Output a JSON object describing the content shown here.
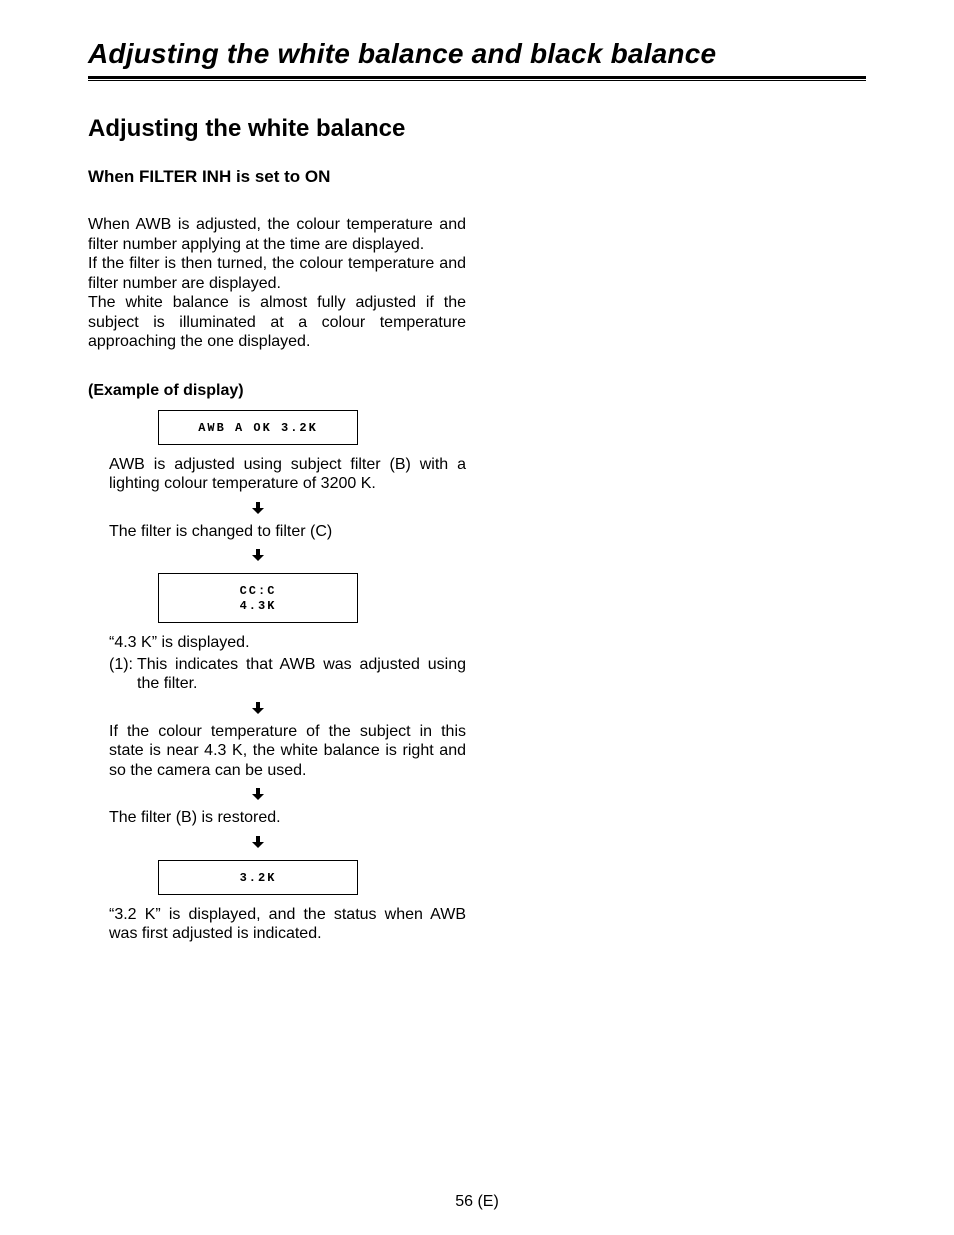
{
  "chapterTitle": "Adjusting the white balance and black balance",
  "sectionTitle": "Adjusting the white balance",
  "subhead": "When FILTER INH is set to ON",
  "intro": "When AWB is adjusted, the colour temperature and filter number applying at the time are displayed.\nIf the filter is then turned, the colour temperature and filter number are displayed.\nThe white balance is almost fully adjusted if the subject is illuminated at a colour temperature approaching the one displayed.",
  "exampleLabel": "(Example of display)",
  "box1": "AWB A OK 3.2K",
  "caption1": "AWB is adjusted using subject filter (B) with a lighting colour temperature of 3200 K.",
  "caption2": "The filter is changed to filter (C)",
  "box2": "CC:C\n4.3K",
  "caption3": "“4.3 K” is displayed.",
  "list1Marker": "(1):",
  "list1Body": "This indicates that AWB was adjusted using the filter.",
  "caption4": "If the colour temperature of the subject in this state is near 4.3 K, the white balance is right and so the camera can be used.",
  "caption5": "The filter (B) is restored.",
  "box3": "3.2K",
  "caption6": "“3.2 K” is displayed, and the status when AWB was first adjusted is indicated.",
  "pageNumber": "56 (E)"
}
